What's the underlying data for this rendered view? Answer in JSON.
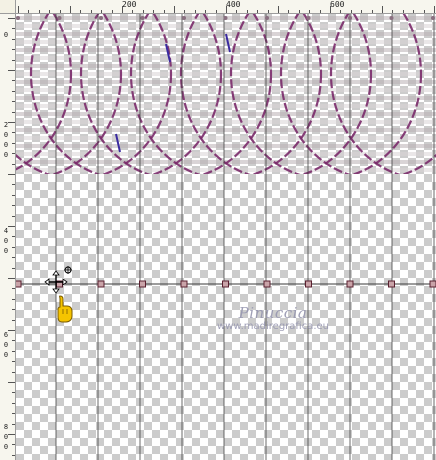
{
  "rulers": {
    "top_labels": [
      "200",
      "400",
      "600"
    ],
    "left_digits": [
      "0",
      "2",
      "0",
      "0",
      "0",
      "4",
      "0",
      "0",
      "6",
      "0",
      "0",
      "8",
      "0",
      "0",
      "1",
      "0",
      "0"
    ]
  },
  "canvas": {
    "mode": "transparent-checkerboard",
    "guide_color": "#3a3a3a",
    "art_colors": [
      "#7a2a6a",
      "#3a2aa0",
      "#b9b0b5"
    ]
  },
  "watermark": {
    "name": "Pinuccia",
    "site": "www.madiregrafica.eu"
  },
  "cursor": {
    "tool": "move-tool",
    "icon": "pointing-hand-icon"
  }
}
